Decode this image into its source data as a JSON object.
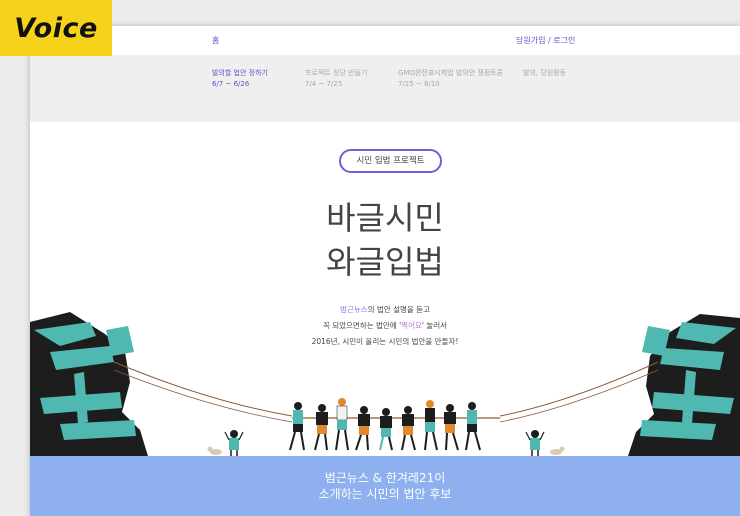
{
  "badge": {
    "label": "Voice"
  },
  "topbar": {
    "home_label": "홈",
    "auth_label": "당원가입 / 로그인"
  },
  "steps": [
    {
      "label": "발의할 법안 정하기",
      "date": "6/7 ~ 6/26",
      "active": true
    },
    {
      "label": "프로젝트 정당 만들기",
      "date": "7/4 ~ 7/25",
      "active": false
    },
    {
      "label": "GMO완전표시제법 발의안 쟁점토론",
      "date": "7/25 ~ 8/10",
      "active": false
    },
    {
      "label": "발의, 당원활동",
      "date": "",
      "active": false
    }
  ],
  "hero": {
    "pill": "시민 입법 프로젝트",
    "title_line1": "바글시민",
    "title_line2": "와글입법",
    "desc_brand": "범근뉴스",
    "desc_line1_rest": "의 법안 설명을 듣고",
    "desc_line2_pre": "꼭 되었으면하는 법안에 '",
    "desc_line2_hl": "찍어요",
    "desc_line2_post": "' 눌러서",
    "desc_line3": "2016년, 시민이 올리는 시민의 법안을 만들자!"
  },
  "footer": {
    "line1": "범근뉴스 & 한겨레21이",
    "line2": "소개하는 시민의 법안 후보"
  },
  "colors": {
    "accent_purple": "#6a4fc8",
    "badge_yellow": "#f6d31a",
    "footer_blue": "#8fb0ee",
    "teal": "#4fb8b0"
  }
}
